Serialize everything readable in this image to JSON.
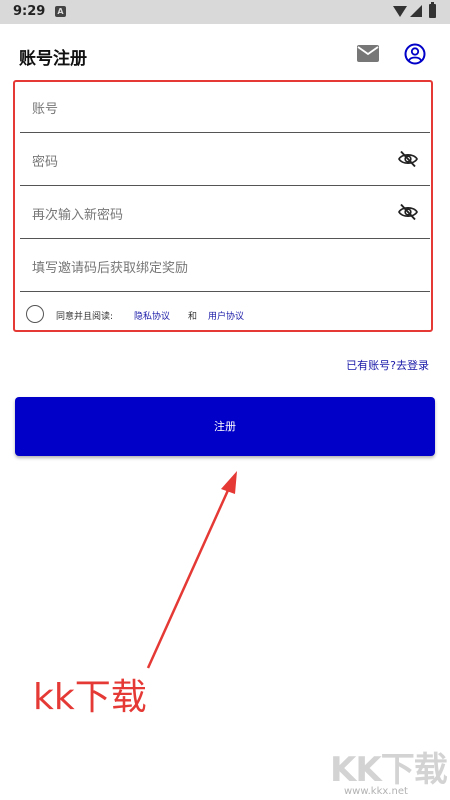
{
  "status_bar": {
    "time": "9:29",
    "notification_glyph": "A"
  },
  "header": {
    "title": "账号注册",
    "icons": [
      "mail-icon",
      "account-circle-icon"
    ]
  },
  "form": {
    "account_placeholder": "账号",
    "password_placeholder": "密码",
    "confirm_password_placeholder": "再次输入新密码",
    "invite_code_placeholder": "填写邀请码后获取绑定奖励",
    "agree_text": "同意并且阅读:",
    "privacy_link": "隐私协议",
    "and_text": "和",
    "user_agreement_link": "用户协议"
  },
  "login_link": "已有账号?去登录",
  "register_button": "注册",
  "annotation": {
    "text": "kk下载",
    "color": "#e53935"
  },
  "watermark": {
    "logo_text": "KK下载",
    "url": "www.kkx.net"
  },
  "colors": {
    "primary": "#0000c8",
    "link": "#1a1aa8",
    "highlight": "#e53935"
  }
}
